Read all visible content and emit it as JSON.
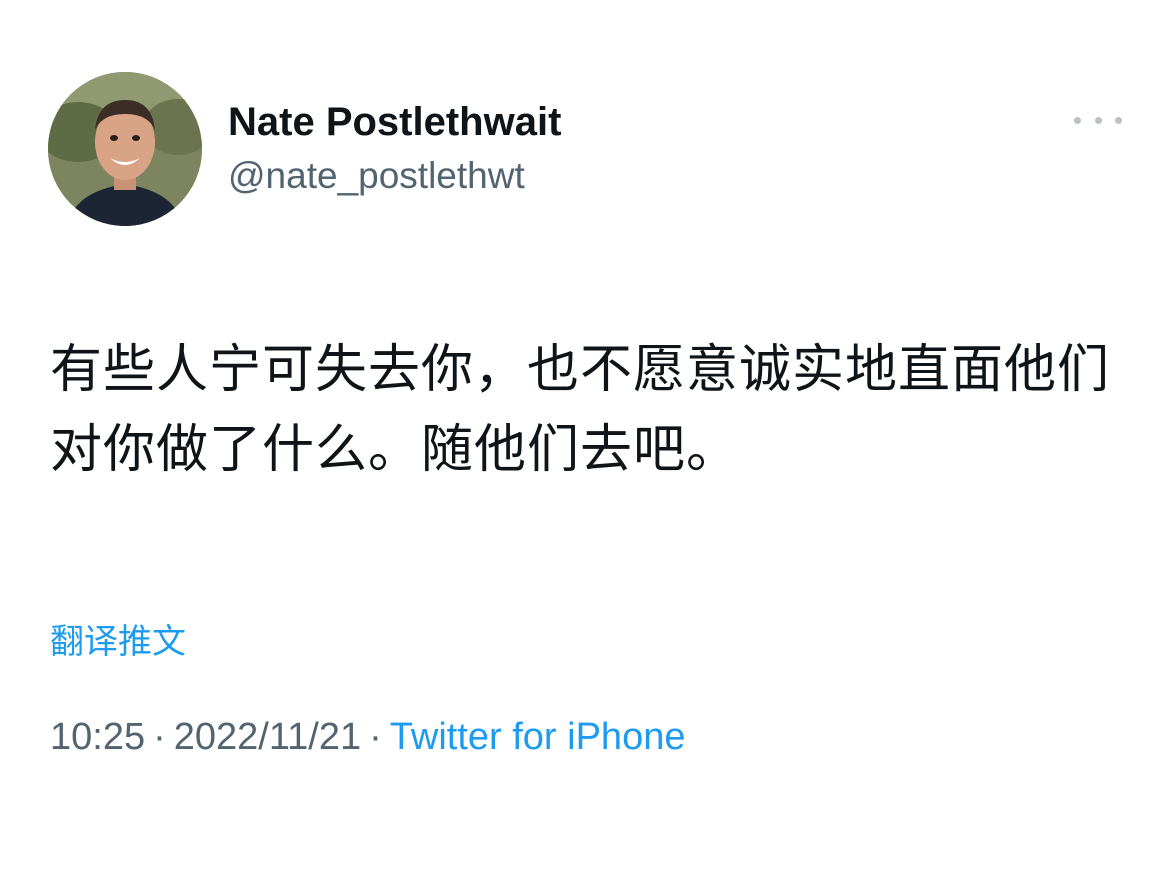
{
  "tweet": {
    "author": {
      "display_name": "Nate Postlethwait",
      "handle": "@nate_postlethwt"
    },
    "text": "有些人宁可失去你，也不愿意诚实地直面他们对你做了什么。随他们去吧。",
    "translate_label": "翻译推文",
    "time": "10:25",
    "date": "2022/11/21",
    "separator": "·",
    "source": "Twitter for iPhone",
    "more_icon": "more-horizontal-icon"
  },
  "colors": {
    "link": "#1d9bf0",
    "secondary_text": "#536471",
    "primary_text": "#0f1419"
  }
}
